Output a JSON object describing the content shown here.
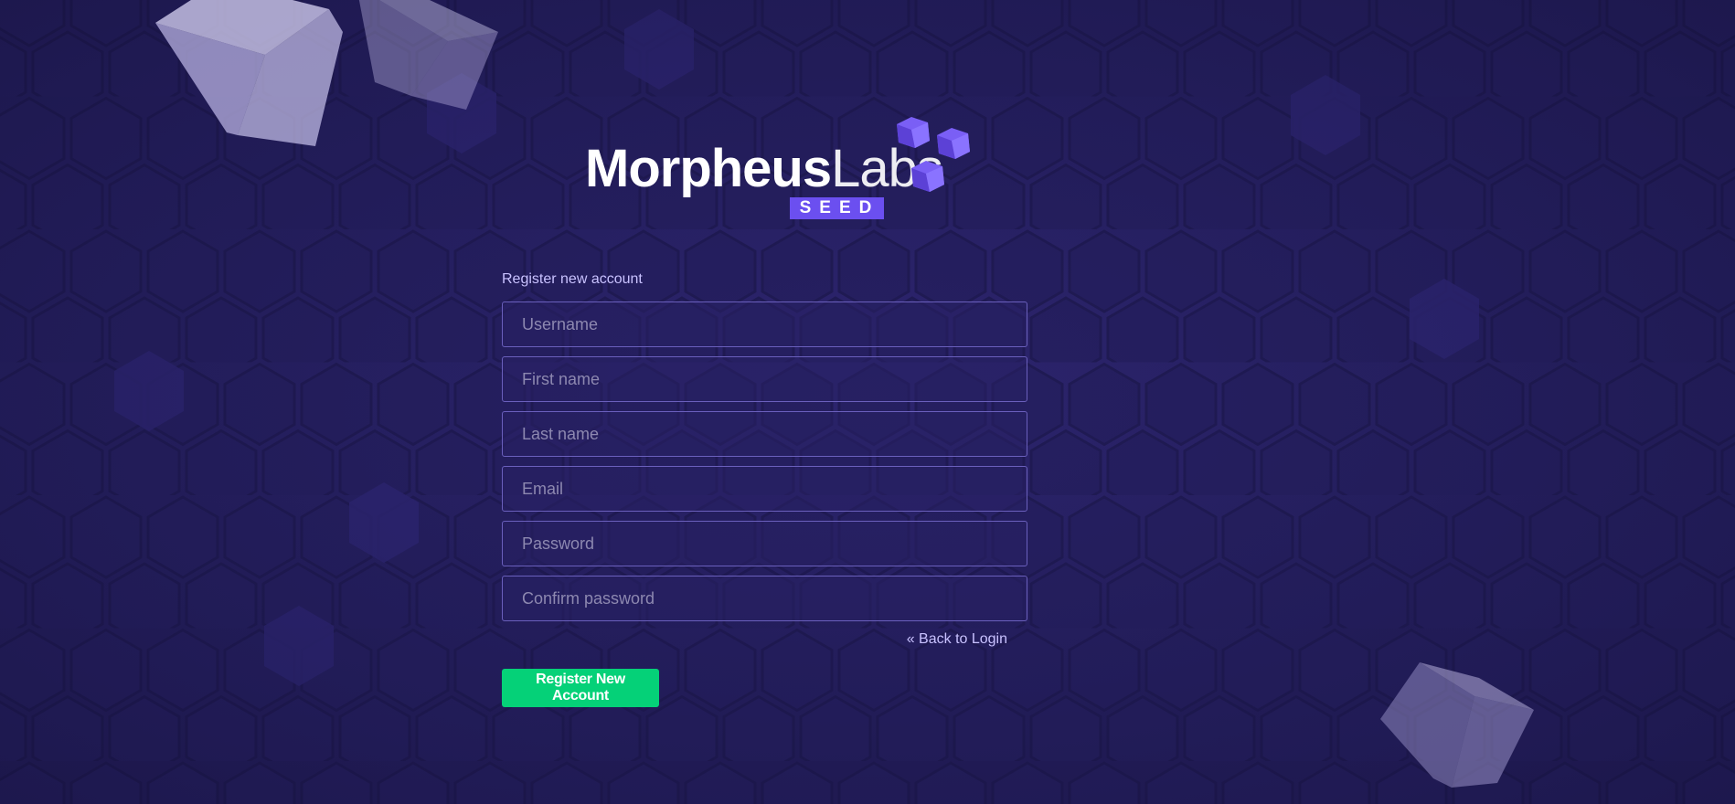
{
  "logo": {
    "brand_bold": "Morpheus",
    "brand_light": "Labs",
    "badge": "SEED"
  },
  "form": {
    "title": "Register new account",
    "fields": [
      {
        "placeholder": "Username",
        "value": ""
      },
      {
        "placeholder": "First name",
        "value": ""
      },
      {
        "placeholder": "Last name",
        "value": ""
      },
      {
        "placeholder": "Email",
        "value": ""
      },
      {
        "placeholder": "Password",
        "value": ""
      },
      {
        "placeholder": "Confirm password",
        "value": ""
      }
    ],
    "back_link": "« Back to Login",
    "submit_label": "Register New Account"
  },
  "colors": {
    "background": "#221c55",
    "accent": "#6b4ff0",
    "primary_button": "#05d178",
    "link": "#c9c2ff"
  },
  "icons": {
    "logo_mark": "three-cubes-icon",
    "decoration": "translucent-cube-icon"
  }
}
